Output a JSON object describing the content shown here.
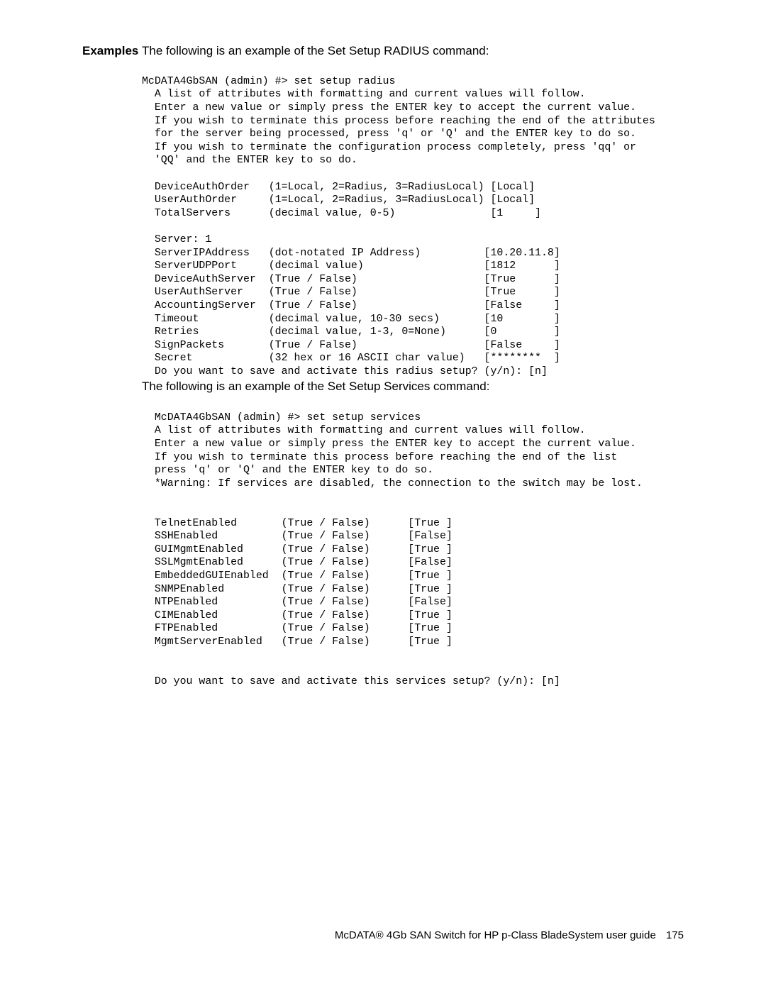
{
  "section_label": "Examples",
  "intro_radius": "The following is an example of the Set Setup RADIUS command:",
  "radius_block": "McDATA4GbSAN (admin) #> set setup radius\n  A list of attributes with formatting and current values will follow.\n  Enter a new value or simply press the ENTER key to accept the current value.\n  If you wish to terminate this process before reaching the end of the attributes\n  for the server being processed, press 'q' or 'Q' and the ENTER key to do so.\n  If you wish to terminate the configuration process completely, press 'qq' or\n  'QQ' and the ENTER key to so do.\n\n  DeviceAuthOrder   (1=Local, 2=Radius, 3=RadiusLocal) [Local]\n  UserAuthOrder     (1=Local, 2=Radius, 3=RadiusLocal) [Local]\n  TotalServers      (decimal value, 0-5)               [1     ]\n\n  Server: 1\n  ServerIPAddress   (dot-notated IP Address)          [10.20.11.8]\n  ServerUDPPort     (decimal value)                   [1812      ]\n  DeviceAuthServer  (True / False)                    [True      ]\n  UserAuthServer    (True / False)                    [True      ]\n  AccountingServer  (True / False)                    [False     ]\n  Timeout           (decimal value, 10-30 secs)       [10        ]\n  Retries           (decimal value, 1-3, 0=None)      [0         ]\n  SignPackets       (True / False)                    [False     ]\n  Secret            (32 hex or 16 ASCII char value)   [********  ]\n  Do you want to save and activate this radius setup? (y/n): [n]",
  "intro_services": "The following is an example of the Set Setup Services command:",
  "services_block": "  McDATA4GbSAN (admin) #> set setup services\n  A list of attributes with formatting and current values will follow.\n  Enter a new value or simply press the ENTER key to accept the current value.\n  If you wish to terminate this process before reaching the end of the list\n  press 'q' or 'Q' and the ENTER key to do so.\n  *Warning: If services are disabled, the connection to the switch may be lost.\n\n\n  TelnetEnabled       (True / False)      [True ]\n  SSHEnabled          (True / False)      [False]\n  GUIMgmtEnabled      (True / False)      [True ]\n  SSLMgmtEnabled      (True / False)      [False]\n  EmbeddedGUIEnabled  (True / False)      [True ]\n  SNMPEnabled         (True / False)      [True ]\n  NTPEnabled          (True / False)      [False]\n  CIMEnabled          (True / False)      [True ]\n  FTPEnabled          (True / False)      [True ]\n  MgmtServerEnabled   (True / False)      [True ]\n\n\n  Do you want to save and activate this services setup? (y/n): [n]",
  "footer_text": "McDATA® 4Gb SAN Switch for HP p-Class BladeSystem user guide",
  "page_number": "175"
}
